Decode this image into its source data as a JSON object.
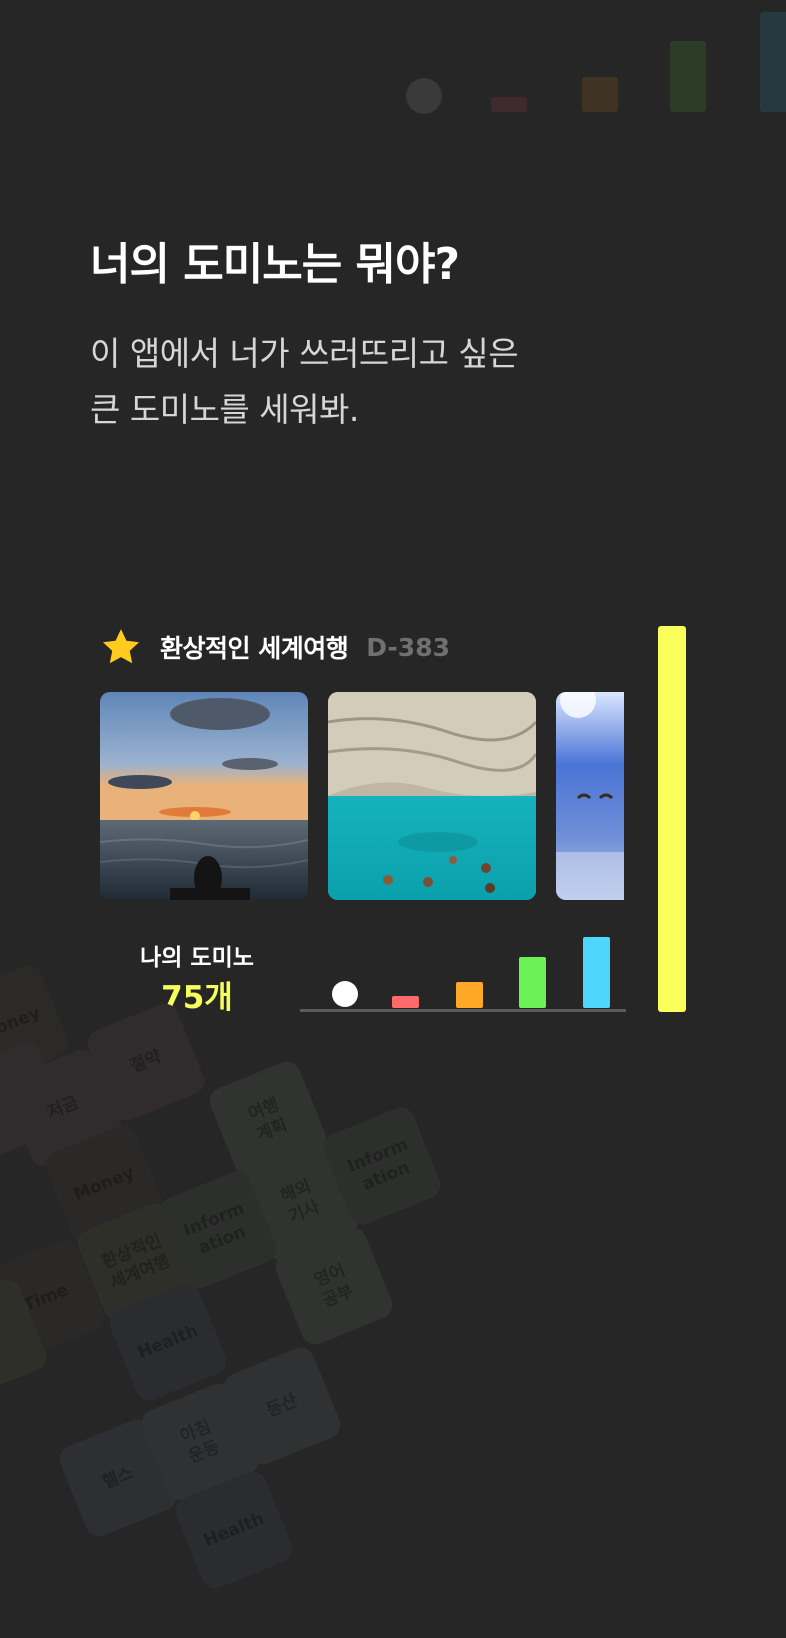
{
  "header": {
    "title": "너의 도미노는 뭐야?",
    "subtitle_line1": "이 앱에서 너가 쓰러뜨리고 싶은",
    "subtitle_line2": "큰 도미노를 세워봐."
  },
  "goal": {
    "icon": "star-icon",
    "name": "환상적인 세계여행",
    "dday": "D-383"
  },
  "photos": [
    {
      "subject": "sunset-sea-swimmer"
    },
    {
      "subject": "turquoise-cove-swimmers"
    },
    {
      "subject": "sky-paragliders"
    }
  ],
  "my_domino": {
    "label": "나의 도미노",
    "count": "75개"
  },
  "colors": {
    "background": "#262626",
    "accent_yellow": "#fbff5c",
    "domino_white": "#ffffff",
    "domino_red": "#ff6b6b",
    "domino_orange": "#ffa726",
    "domino_green": "#6cf254",
    "domino_blue": "#4dd7ff"
  },
  "background_tiles": [
    {
      "label": "Money"
    },
    {
      "label": "저금"
    },
    {
      "label": "절약"
    },
    {
      "label": "Money"
    },
    {
      "label": "여행\n계획"
    },
    {
      "label": "해외\n기사"
    },
    {
      "label": "Inform\nation"
    },
    {
      "label": "Time"
    },
    {
      "label": "환상적인\n세계여행"
    },
    {
      "label": "Inform\nation"
    },
    {
      "label": "영어\n공부"
    },
    {
      "label": "Health"
    },
    {
      "label": "등산"
    },
    {
      "label": "헬스"
    },
    {
      "label": "아침\n운동"
    },
    {
      "label": "Health"
    }
  ]
}
